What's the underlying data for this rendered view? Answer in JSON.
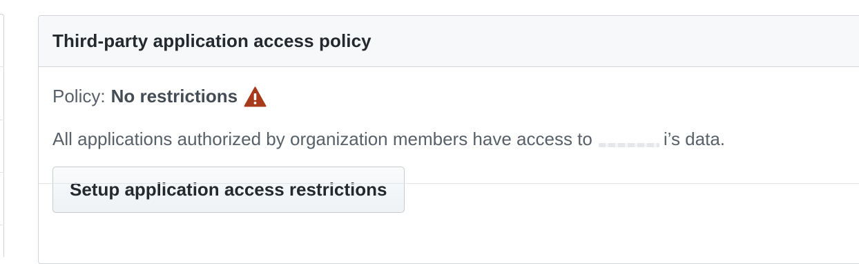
{
  "panel": {
    "title": "Third-party application access policy",
    "policy_label": "Policy:",
    "policy_value": "No restrictions",
    "policy_icon": "warning-triangle-icon",
    "warning_color": "#a73a1a",
    "description_before": "All applications authorized by organization members have access to",
    "description_after": "i’s data.",
    "setup_button_label": "Setup application access restrictions"
  }
}
